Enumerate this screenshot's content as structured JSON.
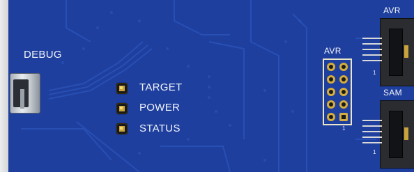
{
  "board": {
    "usb_label": "DEBUG",
    "leds": [
      {
        "label": "TARGET"
      },
      {
        "label": "POWER"
      },
      {
        "label": "STATUS"
      }
    ],
    "avr_header_label": "AVR",
    "avr_header_pin1": "1",
    "connector_top_label": "AVR",
    "connector_top_pin1": "1",
    "connector_bottom_label": "SAM",
    "connector_bottom_pin1": "1"
  },
  "colors": {
    "pcb": "#1e3f9e",
    "silkscreen": "#f2f4fb",
    "gold": "#d3ad3f"
  }
}
